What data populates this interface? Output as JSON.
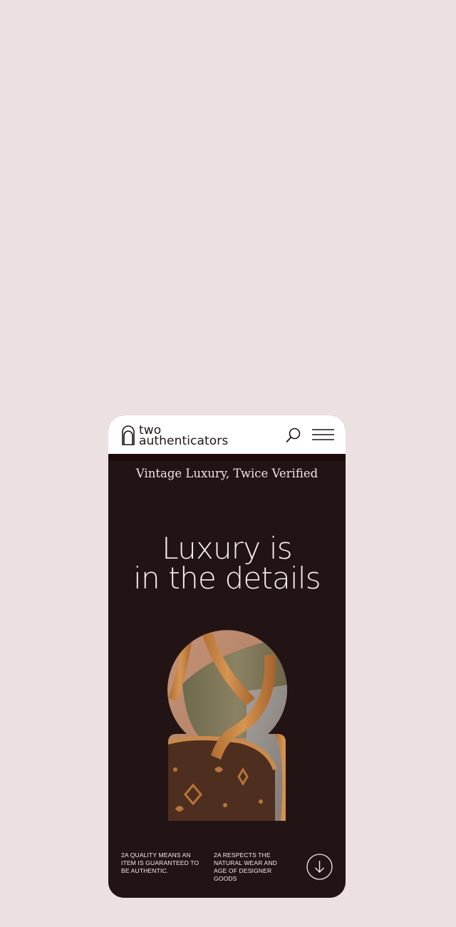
{
  "brand": {
    "logo_line1": "two",
    "logo_line2": "authenticators"
  },
  "header": {
    "search_icon": "search-icon",
    "menu_icon": "hamburger-menu-icon"
  },
  "hero": {
    "tagline": "Vintage Luxury, Twice Verified",
    "headline_line1": "Luxury is",
    "headline_line2": "in the details",
    "image_subject": "monogram leather handbag in keyhole frame"
  },
  "footer": {
    "info_1": "2A QUALITY MEANS AN ITEM IS GUARANTEED TO BE AUTHENTIC.",
    "info_2": "2A RESPECTS THE NATURAL WEAR AND AGE OF DESIGNER GOODS",
    "scroll_icon": "arrow-down-circle-icon"
  },
  "colors": {
    "page_background": "#ebe1e0",
    "hero_background": "#221414",
    "header_background": "#ffffff",
    "text_light": "#f6efee"
  }
}
